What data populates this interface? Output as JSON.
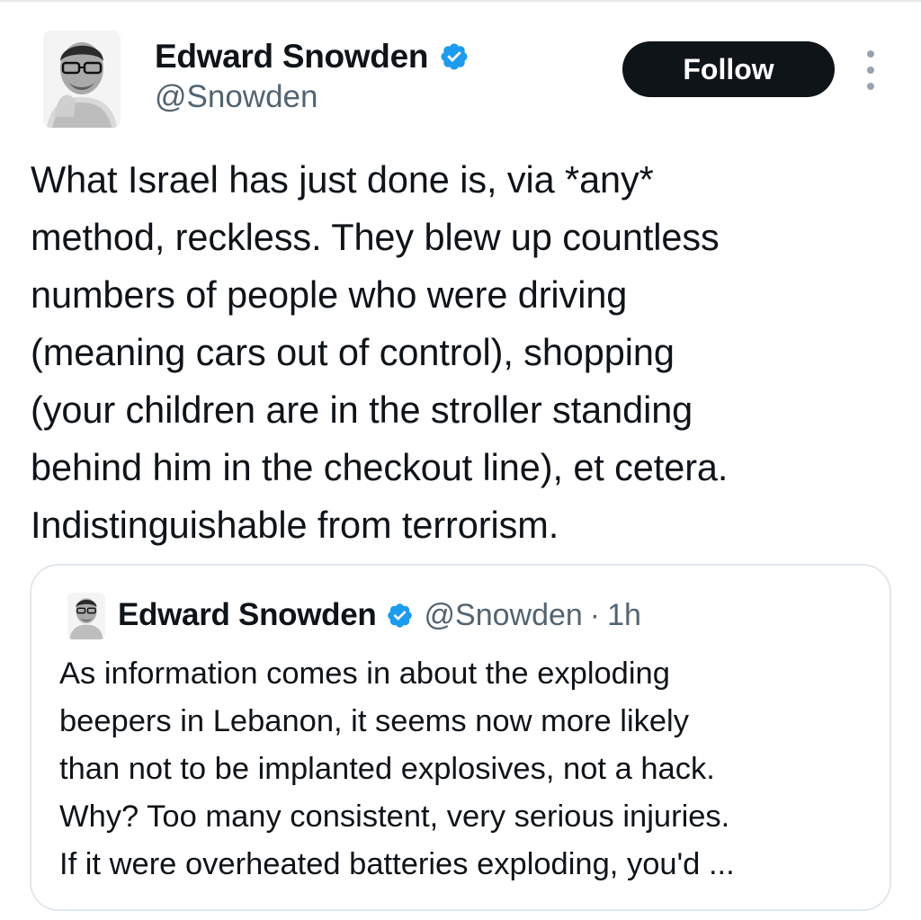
{
  "author": {
    "name": "Edward Snowden",
    "handle": "@Snowden",
    "verified": true,
    "avatar_icon": "person-portrait"
  },
  "actions": {
    "follow_label": "Follow",
    "more_icon": "more-vertical-icon"
  },
  "tweet": {
    "text": "What Israel has just done is, via *any*\nmethod, reckless. They blew up countless\nnumbers of people who were driving\n(meaning cars out of control), shopping\n(your children are in the stroller standing\nbehind him in the checkout line), et cetera.\nIndistinguishable from terrorism."
  },
  "quoted_tweet": {
    "name": "Edward Snowden",
    "handle": "@Snowden",
    "separator": "·",
    "time": "1h",
    "text": "As information comes in about the exploding\nbeepers in Lebanon, it seems now more likely\nthan not to be implanted explosives, not a hack.\nWhy? Too many consistent, very serious injuries.\nIf it were overheated batteries exploding, you'd ..."
  },
  "colors": {
    "verified_badge": "#1d9bf0",
    "follow_button_bg": "#0f1419",
    "secondary_text": "#536471",
    "card_border": "#e1e8ed"
  }
}
